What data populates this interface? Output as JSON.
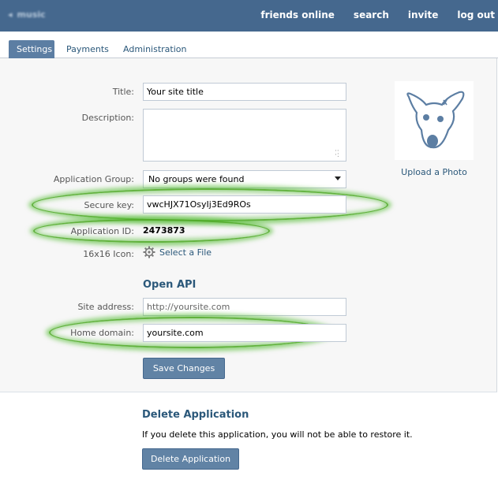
{
  "topbar": {
    "back_label": "music",
    "nav": [
      "friends online",
      "search",
      "invite",
      "log out"
    ]
  },
  "tabs": [
    {
      "label": "Settings",
      "active": true
    },
    {
      "label": "Payments",
      "active": false
    },
    {
      "label": "Administration",
      "active": false
    }
  ],
  "form": {
    "title_label": "Title:",
    "title_value": "Your site title",
    "description_label": "Description:",
    "description_value": "",
    "group_label": "Application Group:",
    "group_value": "No groups were found",
    "secure_key_label": "Secure key:",
    "secure_key_value": "vwcHJX71OsyIj3Ed9ROs",
    "app_id_label": "Application ID:",
    "app_id_value": "2473873",
    "icon_label": "16x16 Icon:",
    "icon_link": "Select a File"
  },
  "open_api": {
    "heading": "Open API",
    "site_address_label": "Site address:",
    "site_address_value": "http://yoursite.com",
    "home_domain_label": "Home domain:",
    "home_domain_value": "yoursite.com",
    "save_button": "Save Changes"
  },
  "photo": {
    "upload_link": "Upload a Photo"
  },
  "delete_app": {
    "heading": "Delete Application",
    "warning": "If you delete this application, you will not be able to restore it.",
    "button": "Delete Application"
  },
  "colors": {
    "topbar": "#45688e",
    "link": "#2b587a",
    "button": "#6183a5",
    "highlight": "#5ab43c"
  }
}
